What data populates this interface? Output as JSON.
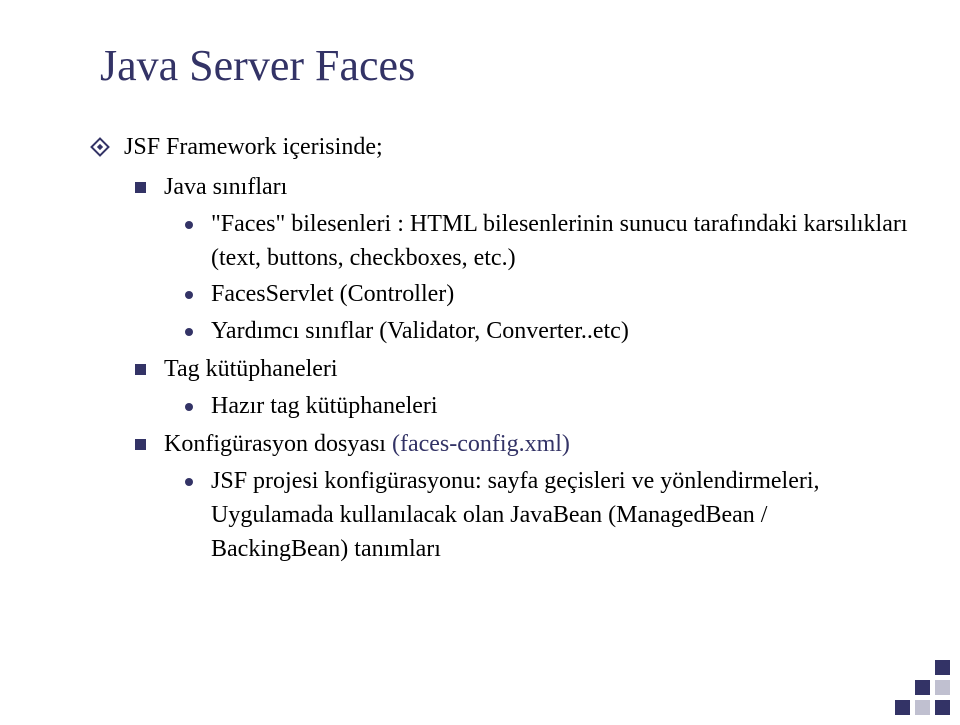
{
  "slide": {
    "title": "Java Server Faces",
    "l1_intro": "JSF Framework içerisinde;",
    "l2_java_classes": "Java sınıfları",
    "l3_faces_desc": "\"Faces\" bilesenleri : HTML bilesenlerinin sunucu tarafındaki karsılıkları (text, buttons, checkboxes, etc.)",
    "l3_faces_servlet": "FacesServlet (Controller)",
    "l3_helper": "Yardımcı sınıflar (Validator, Converter..etc)",
    "l2_taglibs": "Tag kütüphaneleri",
    "l3_readytags": "Hazır tag kütüphaneleri",
    "l2_config": "Konfigürasyon dosyası",
    "l2_config_suffix": " (faces-config.xml)",
    "l3_config_desc": "JSF projesi konfigürasyonu: sayfa geçisleri ve yönlendirmeleri, Uygulamada kullanılacak olan JavaBean (ManagedBean / BackingBean) tanımları"
  }
}
